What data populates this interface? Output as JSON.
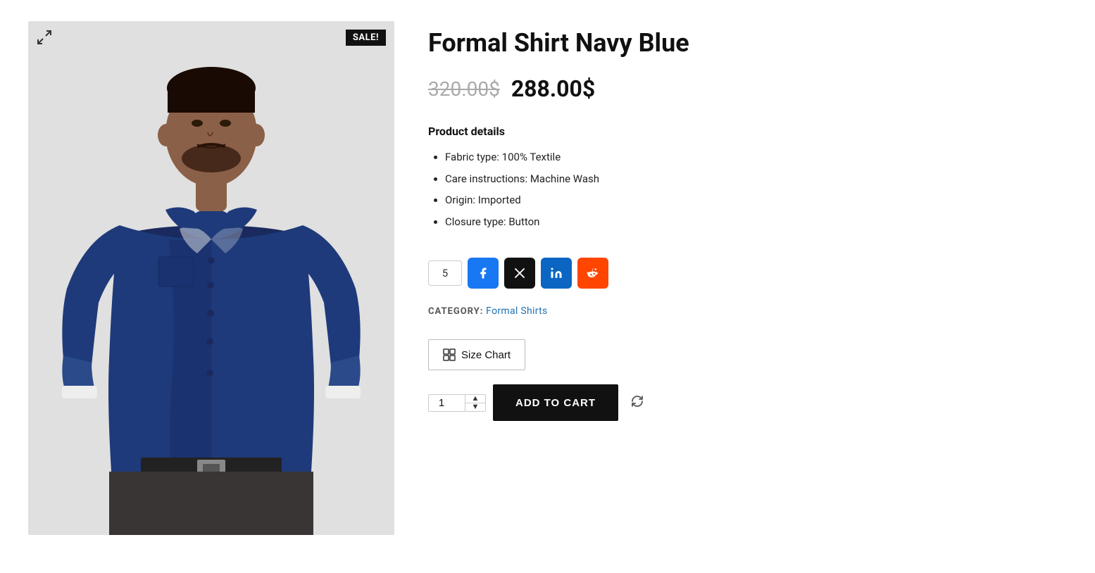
{
  "product": {
    "title": "Formal Shirt Navy Blue",
    "sale_badge": "SALE!",
    "price_original": "320.00$",
    "price_sale": "288.00$",
    "details_heading": "Product details",
    "details": [
      "Fabric type: 100% Textile",
      "Care instructions: Machine Wash",
      "Origin: Imported",
      "Closure type: Button"
    ],
    "share_count": "5",
    "category_label": "CATEGORY:",
    "category_name": "Formal Shirts",
    "size_chart_label": "Size Chart",
    "quantity_value": "1",
    "add_to_cart_label": "ADD TO CART",
    "social": {
      "facebook": "f",
      "twitter": "𝕏",
      "linkedin": "in",
      "reddit": "r/"
    }
  }
}
